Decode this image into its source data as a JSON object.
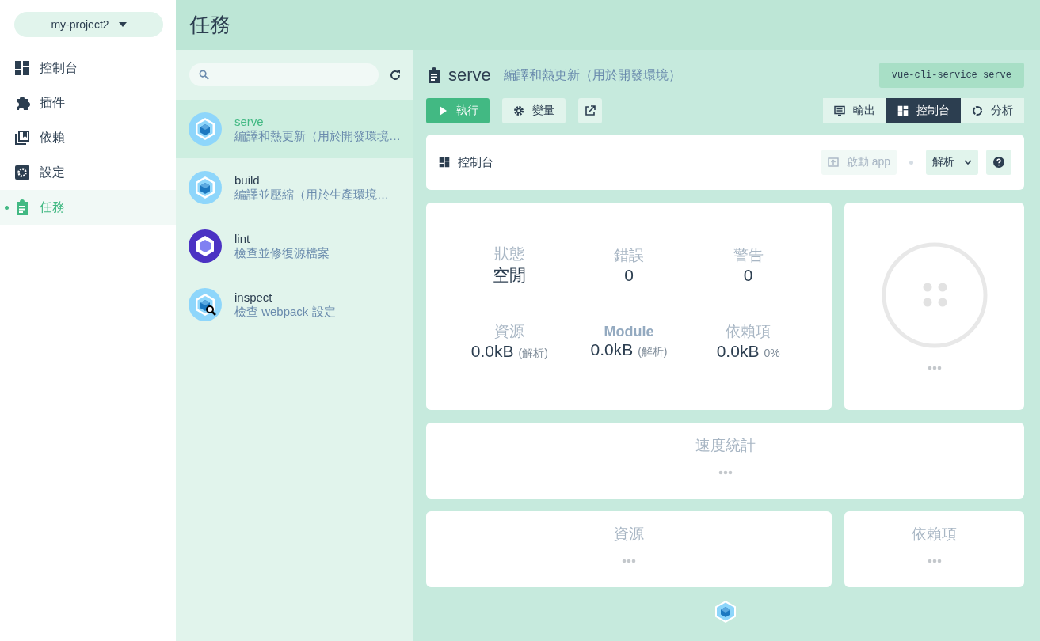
{
  "project_selector": {
    "label": "my-project2"
  },
  "nav": [
    {
      "label": "控制台",
      "kind": "dashboard",
      "selected": false
    },
    {
      "label": "插件",
      "kind": "plugin",
      "selected": false
    },
    {
      "label": "依賴",
      "kind": "library",
      "selected": false
    },
    {
      "label": "設定",
      "kind": "settings",
      "selected": false
    },
    {
      "label": "任務",
      "kind": "tasks",
      "selected": true
    }
  ],
  "page_title": "任務",
  "task_list": {
    "items": [
      {
        "name": "serve",
        "description": "編譯和熱更新（用於開發環境…",
        "kind": "webpack",
        "selected": true
      },
      {
        "name": "build",
        "description": "編譯並壓縮（用於生產環境…",
        "kind": "webpack",
        "selected": false
      },
      {
        "name": "lint",
        "description": "檢查並修復源檔案",
        "kind": "eslint",
        "selected": false
      },
      {
        "name": "inspect",
        "description": "檢查 webpack 設定",
        "kind": "inspect",
        "selected": false
      }
    ]
  },
  "task": {
    "name": "serve",
    "description": "編譯和熱更新（用於開發環境）",
    "command": "vue-cli-service serve",
    "actions": [
      {
        "label": "執行",
        "kind": "run"
      },
      {
        "label": "變量",
        "kind": "settings"
      },
      {
        "kind": "open"
      }
    ],
    "views": [
      {
        "label": "輸出",
        "kind": "output",
        "selected": false
      },
      {
        "label": "控制台",
        "kind": "dashboard",
        "selected": true
      },
      {
        "label": "分析",
        "kind": "analyze",
        "selected": false
      }
    ]
  },
  "dashboard": {
    "title": "控制台",
    "start_app": {
      "label": "啟動 app",
      "disabled": true
    },
    "mode_select": {
      "value": "解析"
    },
    "stats": [
      {
        "label": "狀態",
        "value": "空閒",
        "highlight": false
      },
      {
        "label": "錯誤",
        "value": "0",
        "highlight": false
      },
      {
        "label": "警告",
        "value": "0",
        "highlight": false
      },
      {
        "label": "資源",
        "value": "0.0kB",
        "note": "(解析)",
        "highlight": false
      },
      {
        "label": "Module",
        "value": "0.0kB",
        "note": "(解析)",
        "highlight": true
      },
      {
        "label": "依賴項",
        "value": "0.0kB",
        "note": "0%",
        "highlight": false
      }
    ],
    "cards": [
      {
        "title": "速度統計",
        "kind": "wide"
      },
      {
        "title": "資源",
        "kind": "large"
      },
      {
        "title": "依賴項",
        "kind": "small"
      }
    ]
  }
}
